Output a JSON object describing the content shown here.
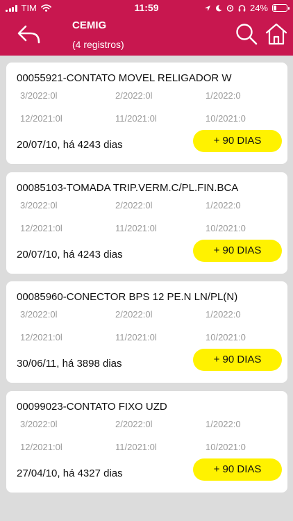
{
  "status_bar": {
    "carrier": "TIM",
    "time": "11:59",
    "battery": "24%",
    "battery_level": 0.24
  },
  "header": {
    "title": "CEMIG",
    "subtitle": "(4 registros)",
    "back_icon": "back-arrow-icon",
    "search_icon": "search-icon",
    "home_icon": "home-icon"
  },
  "colors": {
    "header": "#c8174f",
    "badge": "#fff200",
    "background": "#dcdcdc"
  },
  "items": [
    {
      "name": "00055921-CONTATO MOVEL RELIGADOR W",
      "periods": [
        "3/2022:0l",
        "2/2022:0l",
        "1/2022:0",
        "12/2021:0l",
        "11/2021:0l",
        "10/2021:0"
      ],
      "since": "20/07/10, há 4243 dias",
      "badge": "+ 90 DIAS"
    },
    {
      "name": "00085103-TOMADA TRIP.VERM.C/PL.FIN.BCA",
      "periods": [
        "3/2022:0l",
        "2/2022:0l",
        "1/2022:0",
        "12/2021:0l",
        "11/2021:0l",
        "10/2021:0"
      ],
      "since": "20/07/10, há 4243 dias",
      "badge": "+ 90 DIAS"
    },
    {
      "name": "00085960-CONECTOR BPS 12 PE.N LN/PL(N)",
      "periods": [
        "3/2022:0l",
        "2/2022:0l",
        "1/2022:0",
        "12/2021:0l",
        "11/2021:0l",
        "10/2021:0"
      ],
      "since": "30/06/11, há 3898 dias",
      "badge": "+ 90 DIAS"
    },
    {
      "name": "00099023-CONTATO FIXO UZD",
      "periods": [
        "3/2022:0l",
        "2/2022:0l",
        "1/2022:0",
        "12/2021:0l",
        "11/2021:0l",
        "10/2021:0"
      ],
      "since": "27/04/10, há 4327 dias",
      "badge": "+ 90 DIAS"
    }
  ]
}
